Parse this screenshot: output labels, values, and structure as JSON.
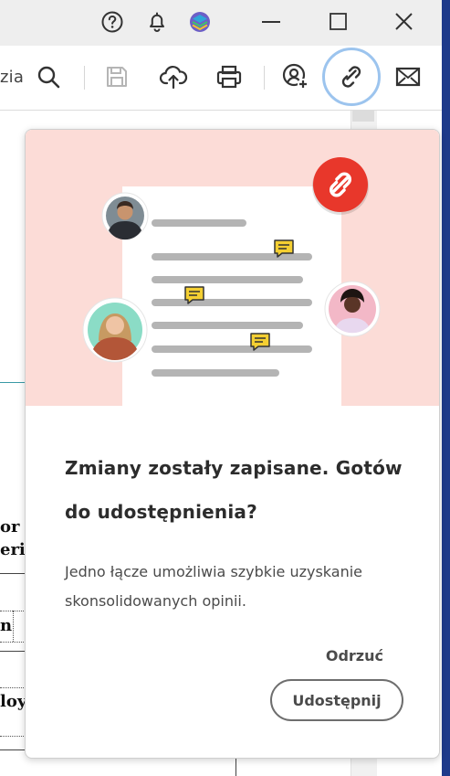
{
  "toolbar": {
    "partial_text": "zia"
  },
  "document": {
    "fragments": [
      "or",
      "erin",
      "n",
      "loy"
    ]
  },
  "dialog": {
    "title": "Zmiany zostały zapisane. Gotów do udostępnienia?",
    "body": "Jedno łącze umożliwia szybkie uzyskanie skonsolidowanych opinii.",
    "dismiss_label": "Odrzuć",
    "share_label": "Udostępnij"
  },
  "colors": {
    "illustration_bg": "#fcdcd7",
    "link_badge": "#e8372b",
    "comment_bubble": "#f4cf32",
    "focus_ring": "#9cc4ee"
  },
  "icons": [
    "help-icon",
    "bell-icon",
    "profile-icon",
    "minimize-icon",
    "maximize-icon",
    "close-icon",
    "search-icon",
    "save-icon",
    "upload-cloud-icon",
    "print-icon",
    "add-person-icon",
    "link-icon",
    "mail-icon"
  ]
}
